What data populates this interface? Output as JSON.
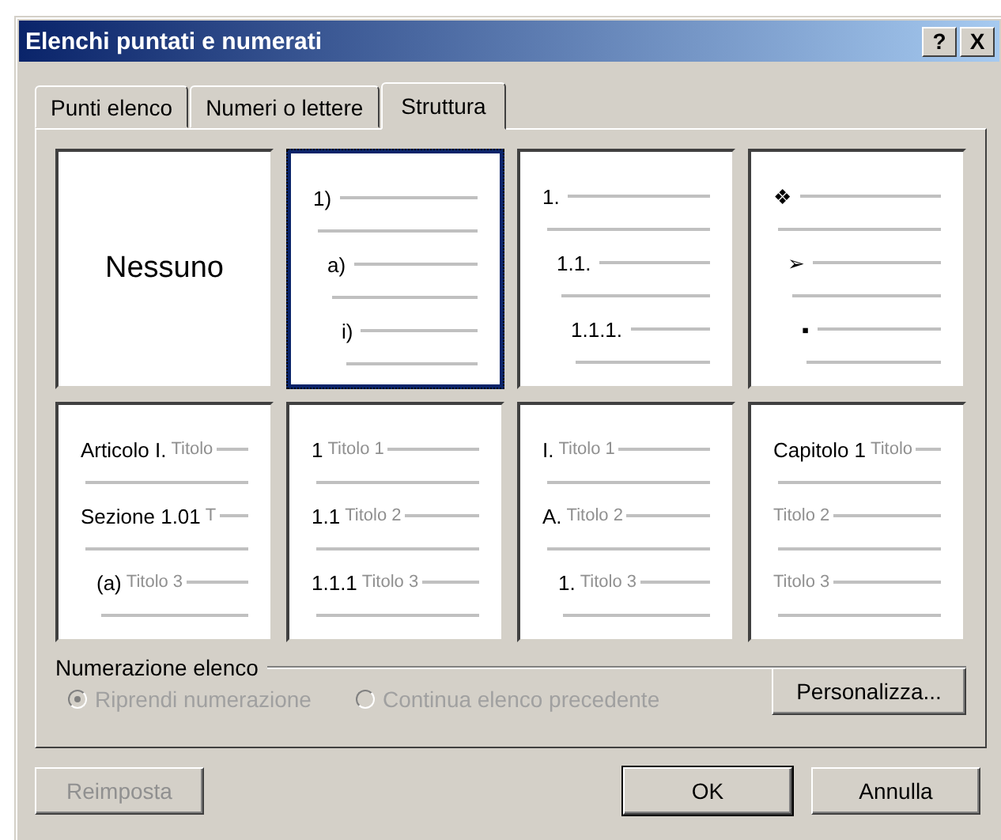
{
  "window": {
    "title": "Elenchi puntati e numerati",
    "title_buttons": [
      "?",
      "X"
    ]
  },
  "tabs": [
    {
      "label": "Punti elenco",
      "selected": false
    },
    {
      "label": "Numeri o lettere",
      "selected": false
    },
    {
      "label": "Struttura",
      "selected": true
    }
  ],
  "styles": [
    {
      "kind": "none",
      "selected": false,
      "text": "Nessuno"
    },
    {
      "kind": "indented",
      "selected": true,
      "levels": [
        {
          "label": "1)"
        },
        {
          "label": "a)"
        },
        {
          "label": "i)"
        }
      ]
    },
    {
      "kind": "indented",
      "selected": false,
      "levels": [
        {
          "label": "1."
        },
        {
          "label": "1.1."
        },
        {
          "label": "1.1.1."
        }
      ]
    },
    {
      "kind": "indented",
      "selected": false,
      "levels": [
        {
          "label": "❖"
        },
        {
          "label": "➢"
        },
        {
          "label": "▪"
        }
      ]
    },
    {
      "kind": "indented",
      "selected": false,
      "levels": [
        {
          "label": "Articolo I.",
          "title": "Titolo"
        },
        {
          "label": "Sezione 1.01",
          "title": "T"
        },
        {
          "label": "(a)",
          "title": "Titolo 3"
        }
      ]
    },
    {
      "kind": "flat",
      "selected": false,
      "levels": [
        {
          "label": "1",
          "title": "Titolo 1"
        },
        {
          "label": "1.1",
          "title": "Titolo 2"
        },
        {
          "label": "1.1.1",
          "title": "Titolo 3"
        }
      ]
    },
    {
      "kind": "indented",
      "selected": false,
      "levels": [
        {
          "label": "I.",
          "title": "Titolo 1"
        },
        {
          "label": "A.",
          "title": "Titolo 2"
        },
        {
          "label": "1.",
          "title": "Titolo 3"
        }
      ]
    },
    {
      "kind": "flat",
      "selected": false,
      "levels": [
        {
          "label": "Capitolo 1",
          "title": "Titolo"
        },
        {
          "title": "Titolo 2"
        },
        {
          "title": "Titolo 3"
        }
      ]
    }
  ],
  "numbering": {
    "heading": "Numerazione elenco",
    "options": [
      {
        "label": "Riprendi numerazione",
        "selected": true,
        "disabled": true
      },
      {
        "label": "Continua elenco precedente",
        "selected": false,
        "disabled": true
      }
    ],
    "customize_button": "Personalizza..."
  },
  "buttons": [
    {
      "label": "Reimposta",
      "disabled": true,
      "default": false
    },
    {
      "label": "OK",
      "disabled": false,
      "default": true
    },
    {
      "label": "Annulla",
      "disabled": false,
      "default": false
    }
  ]
}
